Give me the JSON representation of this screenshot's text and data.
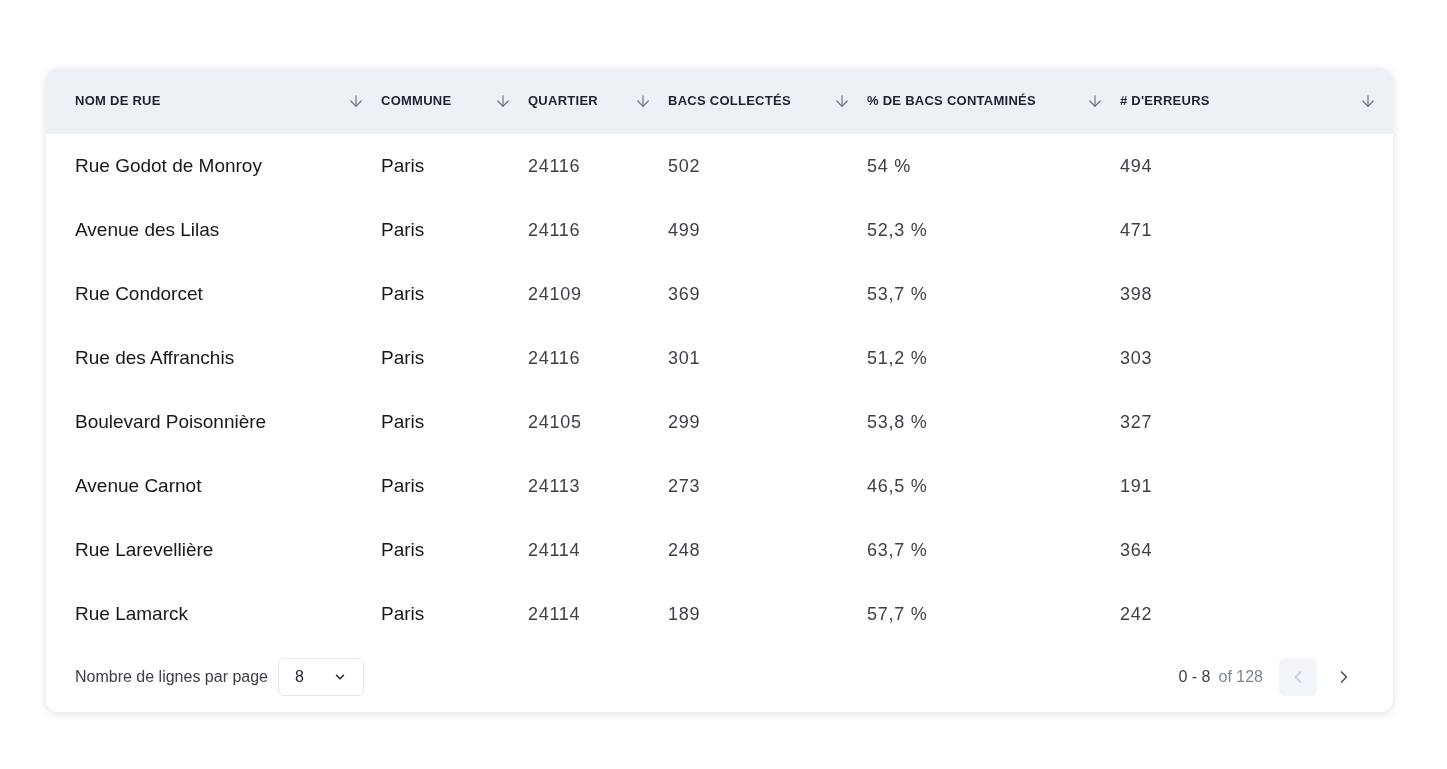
{
  "table": {
    "columns": [
      "NOM DE RUE",
      "COMMUNE",
      "QUARTIER",
      "BACS COLLECTÉS",
      "% DE BACS CONTAMINÉS",
      "# D'ERREURS"
    ],
    "rows": [
      [
        "Rue Godot de Monroy",
        "Paris",
        "24116",
        "502",
        "54 %",
        "494"
      ],
      [
        "Avenue des Lilas",
        "Paris",
        "24116",
        "499",
        "52,3 %",
        "471"
      ],
      [
        "Rue Condorcet",
        "Paris",
        "24109",
        "369",
        "53,7 %",
        "398"
      ],
      [
        "Rue des Affranchis",
        "Paris",
        "24116",
        "301",
        "51,2 %",
        "303"
      ],
      [
        "Boulevard Poisonnière",
        "Paris",
        "24105",
        "299",
        "53,8 %",
        "327"
      ],
      [
        "Avenue Carnot",
        "Paris",
        "24113",
        "273",
        "46,5 %",
        "191"
      ],
      [
        "Rue Larevellière",
        "Paris",
        "24114",
        "248",
        "63,7 %",
        "364"
      ],
      [
        "Rue Lamarck",
        "Paris",
        "24114",
        "189",
        "57,7 %",
        "242"
      ]
    ]
  },
  "pagination": {
    "rows_label": "Nombre de lignes par page",
    "rows_value": "8",
    "range": "0 - 8",
    "total": "of 128",
    "prev": {
      "disabled": true
    },
    "next": {
      "disabled": false
    }
  }
}
